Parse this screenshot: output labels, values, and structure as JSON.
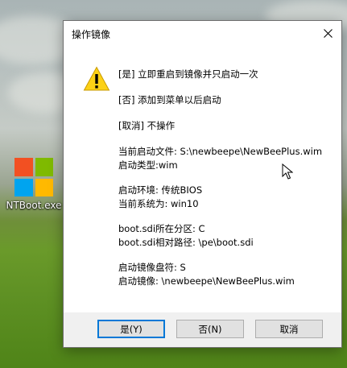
{
  "desktop": {
    "icon_label": "NTBoot.exe",
    "logo_colors": [
      "#f25022",
      "#7fba00",
      "#00a4ef",
      "#ffb900"
    ]
  },
  "dialog": {
    "title": "操作镜像",
    "lines": [
      "[是] 立即重启到镜像并只启动一次",
      "[否] 添加到菜单以后启动",
      "[取消] 不操作",
      "当前启动文件: S:\\newbeepe\\NewBeePlus.wim",
      "启动类型:wim",
      "启动环境: 传统BIOS",
      "当前系统为: win10",
      "boot.sdi所在分区: C",
      "boot.sdi相对路径: \\pe\\boot.sdi",
      "启动镜像盘符: S",
      "启动镜像: \\newbeepe\\NewBeePlus.wim"
    ],
    "buttons": {
      "yes": "是(Y)",
      "no": "否(N)",
      "cancel": "取消"
    },
    "accent_color": "#0078d7",
    "warning_color": "#fcd116"
  }
}
